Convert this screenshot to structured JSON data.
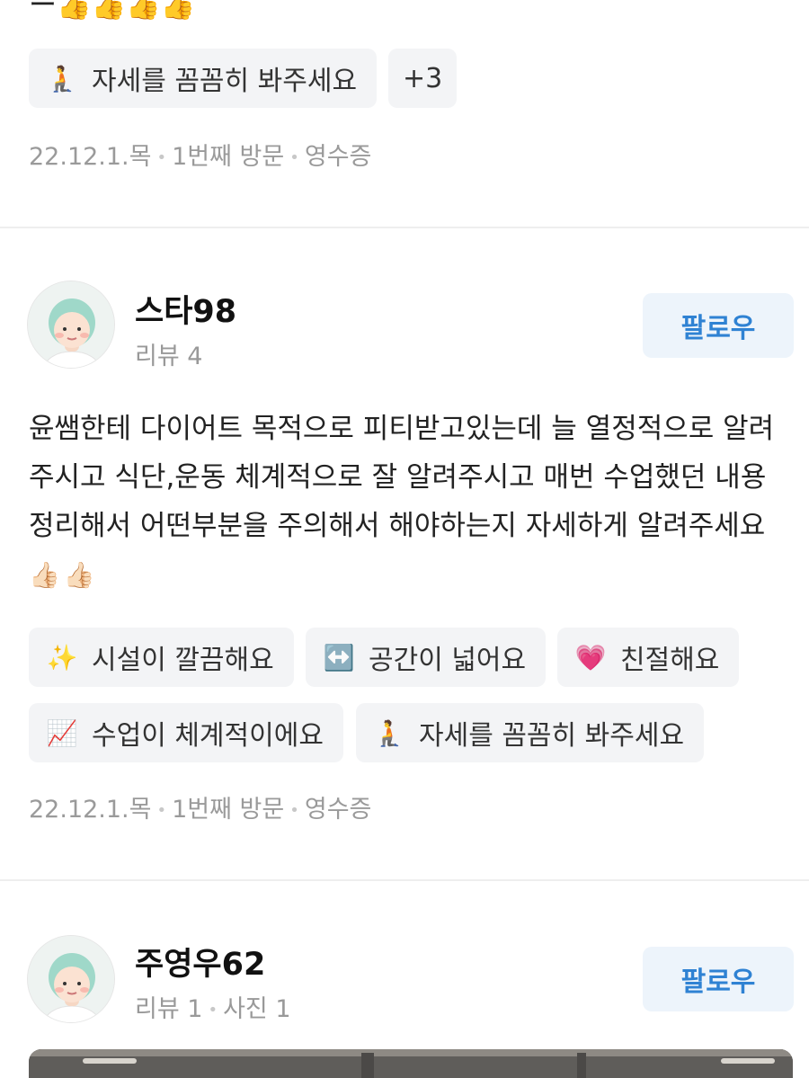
{
  "previous_review": {
    "text_tail": "ー👍👍👍👍",
    "chips": [
      {
        "emoji": "🧎",
        "label": "자세를 꼼꼼히 봐주세요"
      }
    ],
    "more_chip": "+3",
    "meta": {
      "date": "22.12.1.목",
      "visit": "1번째 방문",
      "proof": "영수증"
    }
  },
  "review": {
    "username": "스타98",
    "stats": "리뷰 4",
    "follow_label": "팔로우",
    "body": "윤쌤한테 다이어트 목적으로 피티받고있는데 늘 열정적으로 알려주시고 식단,운동 체계적으로 잘 알려주시고 매번 수업했던 내용 정리해서 어떤부분을 주의해서 해야하는지 자세하게 알려주세요",
    "body_emoji": "👍🏻👍🏻",
    "chips": [
      {
        "emoji": "✨",
        "label": "시설이 깔끔해요"
      },
      {
        "emoji": "↔️",
        "label": "공간이 넓어요"
      },
      {
        "emoji": "💗",
        "label": "친절해요"
      },
      {
        "emoji": "📈",
        "label": "수업이 체계적이에요"
      },
      {
        "emoji": "🧎",
        "label": "자세를 꼼꼼히 봐주세요"
      }
    ],
    "meta": {
      "date": "22.12.1.목",
      "visit": "1번째 방문",
      "proof": "영수증"
    }
  },
  "next_review": {
    "username": "주영우62",
    "stats_reviews": "리뷰 1",
    "stats_photos": "사진 1",
    "follow_label": "팔로우"
  }
}
